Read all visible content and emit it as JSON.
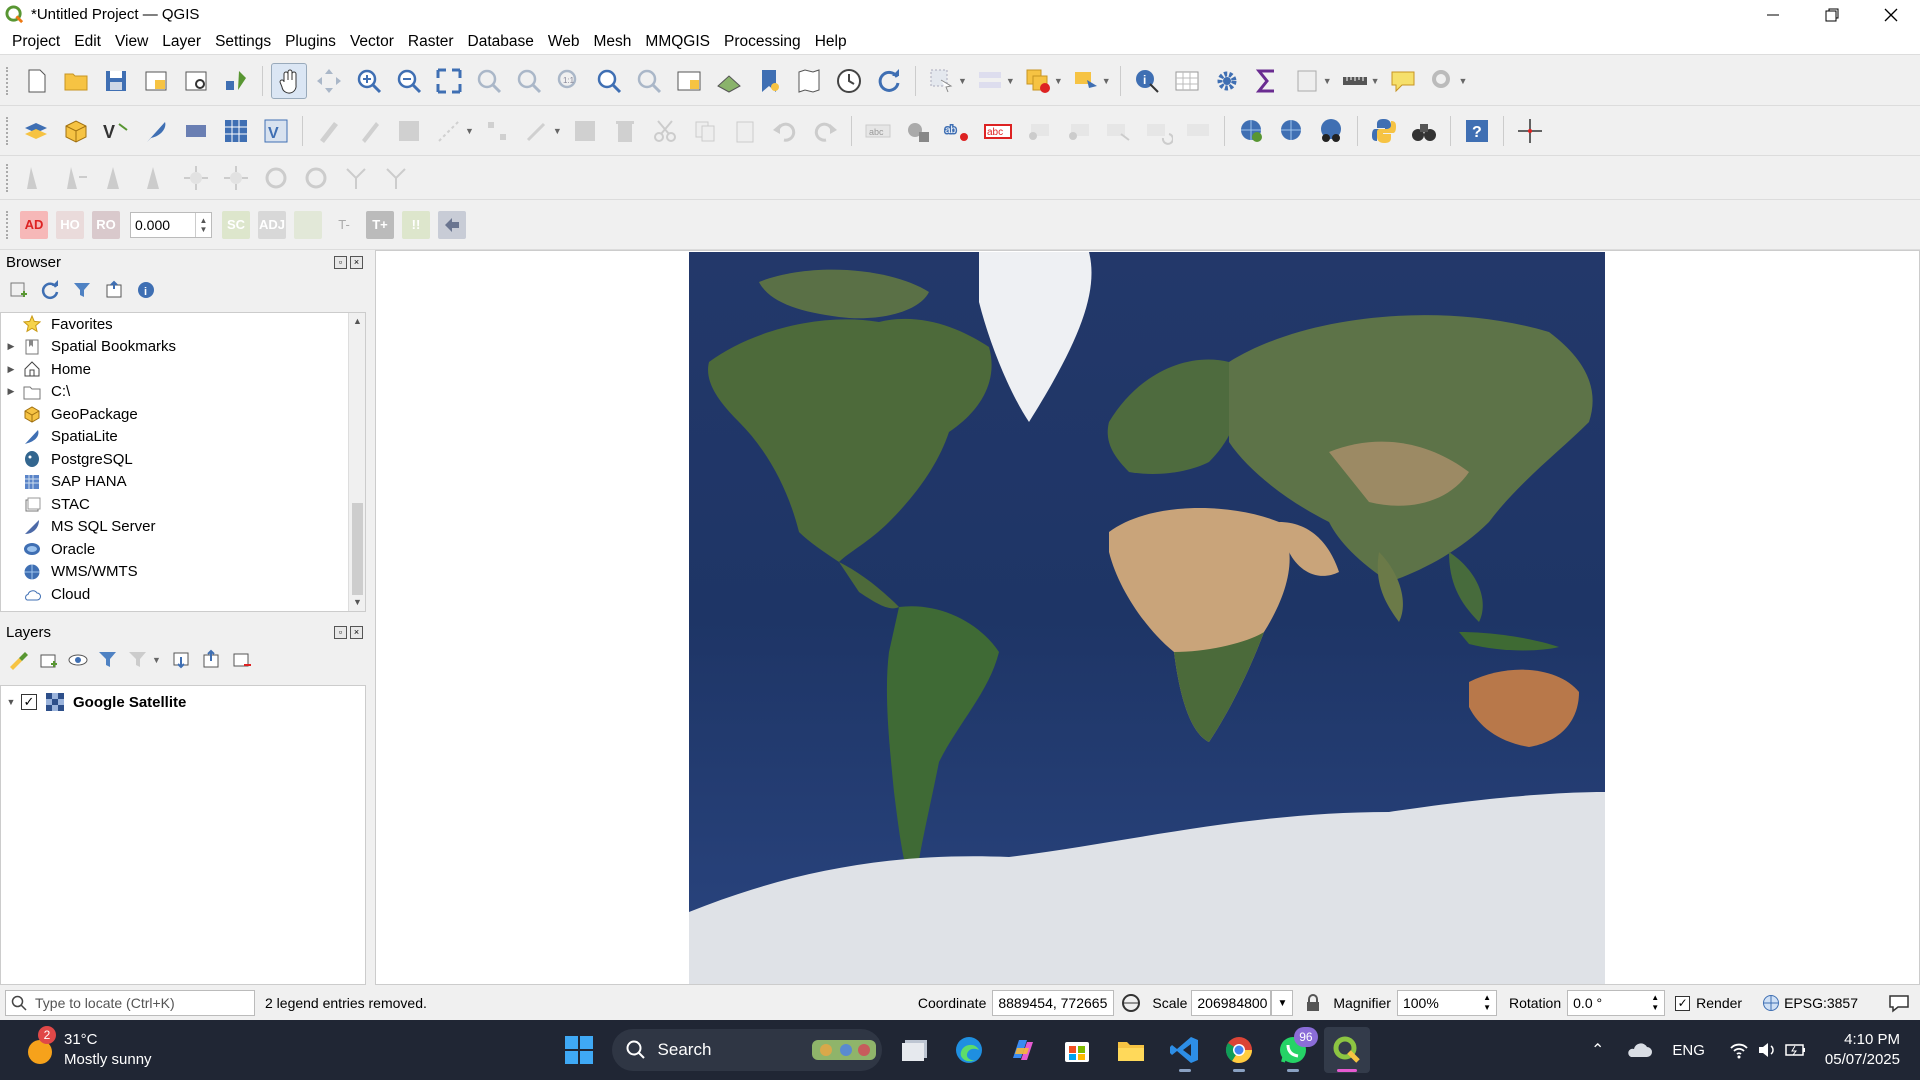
{
  "window": {
    "title": "*Untitled Project — QGIS"
  },
  "menu": [
    "Project",
    "Edit",
    "View",
    "Layer",
    "Settings",
    "Plugins",
    "Vector",
    "Raster",
    "Database",
    "Web",
    "Mesh",
    "MMQGIS",
    "Processing",
    "Help"
  ],
  "advanced_digitizing": {
    "buttons": [
      "AD",
      "HO",
      "RO",
      "SC",
      "ADJ",
      "T-",
      "T+",
      "!!"
    ],
    "angle_value": "0.000"
  },
  "browser": {
    "title": "Browser",
    "items": [
      {
        "label": "Favorites",
        "icon": "star-icon",
        "expand": false
      },
      {
        "label": "Spatial Bookmarks",
        "icon": "bookmarks-icon",
        "expand": true
      },
      {
        "label": "Home",
        "icon": "home-icon",
        "expand": true
      },
      {
        "label": "C:\\",
        "icon": "folder-icon",
        "expand": true
      },
      {
        "label": "GeoPackage",
        "icon": "geopackage-icon",
        "expand": false
      },
      {
        "label": "SpatiaLite",
        "icon": "spatialite-icon",
        "expand": false
      },
      {
        "label": "PostgreSQL",
        "icon": "postgresql-icon",
        "expand": false
      },
      {
        "label": "SAP HANA",
        "icon": "sap-hana-icon",
        "expand": false
      },
      {
        "label": "STAC",
        "icon": "stac-icon",
        "expand": false
      },
      {
        "label": "MS SQL Server",
        "icon": "mssql-icon",
        "expand": false
      },
      {
        "label": "Oracle",
        "icon": "oracle-icon",
        "expand": false
      },
      {
        "label": "WMS/WMTS",
        "icon": "wms-icon",
        "expand": false
      },
      {
        "label": "Cloud",
        "icon": "cloud-icon",
        "expand": false
      }
    ]
  },
  "layers": {
    "title": "Layers",
    "items": [
      {
        "label": "Google Satellite",
        "checked": true
      }
    ]
  },
  "status": {
    "locate_placeholder": "Type to locate (Ctrl+K)",
    "message": "2 legend entries removed.",
    "coordinate_label": "Coordinate",
    "coordinate_value": "8889454, 772665",
    "scale_label": "Scale",
    "scale_value": "206984800",
    "magnifier_label": "Magnifier",
    "magnifier_value": "100%",
    "rotation_label": "Rotation",
    "rotation_value": "0.0 °",
    "render_label": "Render",
    "crs": "EPSG:3857"
  },
  "taskbar": {
    "weather_temp": "31°C",
    "weather_desc": "Mostly sunny",
    "weather_badge": "2",
    "search": "Search",
    "whatsapp_badge": "96",
    "language": "ENG",
    "time": "4:10 PM",
    "date": "05/07/2025"
  }
}
